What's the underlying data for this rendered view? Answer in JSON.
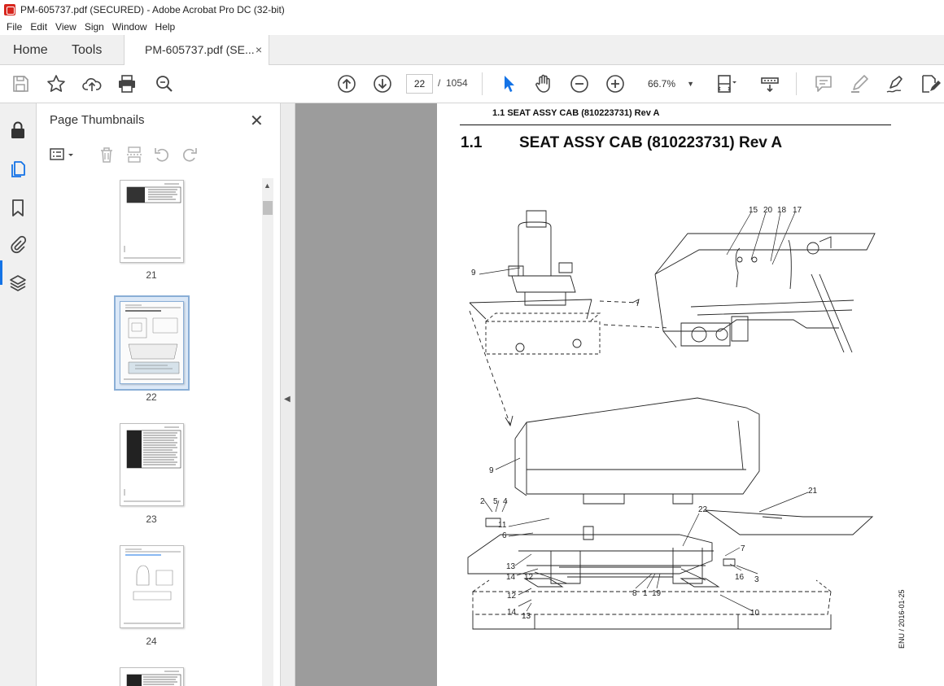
{
  "window": {
    "title": "PM-605737.pdf (SECURED) - Adobe Acrobat Pro DC (32-bit)"
  },
  "menu": [
    "File",
    "Edit",
    "View",
    "Sign",
    "Window",
    "Help"
  ],
  "tabs": {
    "home": "Home",
    "tools": "Tools",
    "document": "PM-605737.pdf (SE...",
    "close": "×"
  },
  "toolbar": {
    "current_page": "22",
    "separator": "/",
    "total_pages": "1054",
    "zoom": "66.7%",
    "caret": "▼"
  },
  "thumbnails": {
    "title": "Page Thumbnails",
    "close": "✕",
    "pages": [
      {
        "label": "21",
        "selected": false
      },
      {
        "label": "22",
        "selected": true
      },
      {
        "label": "23",
        "selected": false
      },
      {
        "label": "24",
        "selected": false
      }
    ]
  },
  "document": {
    "header": "1.1 SEAT ASSY CAB (810223731) Rev A",
    "section_number": "1.1",
    "section_title": "SEAT ASSY CAB (810223731) Rev A",
    "side_note": "ENU / 2016-01-25",
    "callouts": [
      "15",
      "20",
      "18",
      "17",
      "9",
      "9",
      "21",
      "2",
      "5",
      "4",
      "11",
      "6",
      "22",
      "7",
      "13",
      "14",
      "12",
      "16",
      "3",
      "8",
      "1",
      "19",
      "12",
      "14",
      "13",
      "10"
    ]
  },
  "colors": {
    "accent": "#1473e6",
    "doc_background": "#9c9c9c",
    "panel_background": "#f0f0f0"
  }
}
